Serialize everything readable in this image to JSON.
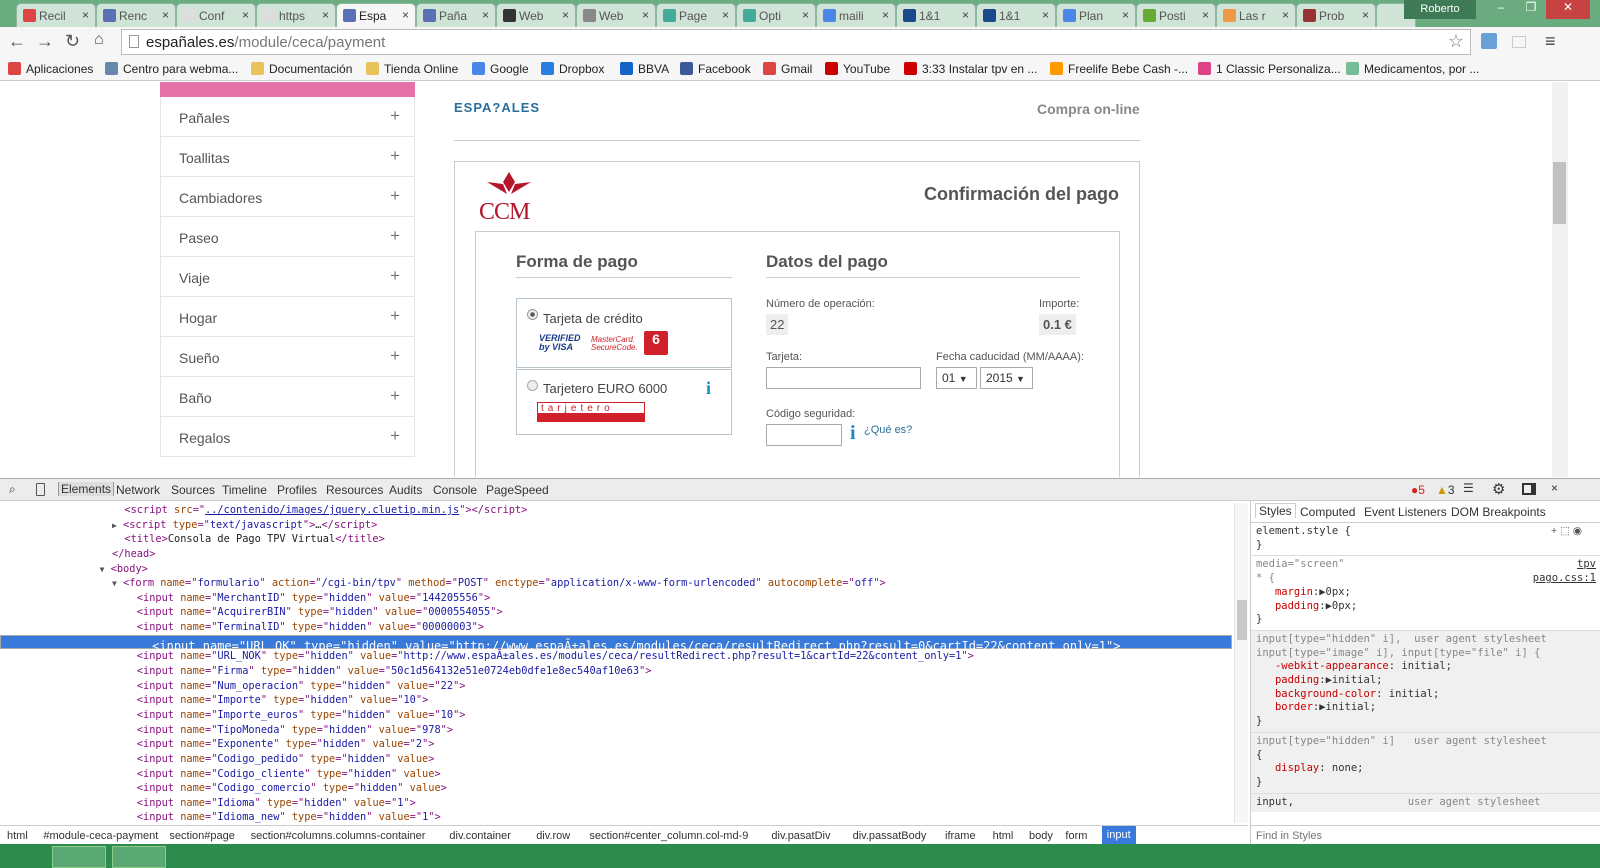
{
  "browser": {
    "tabs": [
      {
        "label": "Recil",
        "color": "#d44"
      },
      {
        "label": "Renc",
        "color": "#5b6fb5"
      },
      {
        "label": "Conf",
        "color": "#ddd"
      },
      {
        "label": "https",
        "color": "#ddd"
      },
      {
        "label": "Espa",
        "color": "#5b6fb5",
        "active": true
      },
      {
        "label": "Paña",
        "color": "#5b6fb5"
      },
      {
        "label": "Web",
        "color": "#333"
      },
      {
        "label": "Web",
        "color": "#888"
      },
      {
        "label": "Page",
        "color": "#4a9"
      },
      {
        "label": "Opti",
        "color": "#4a9"
      },
      {
        "label": "maili",
        "color": "#4a86e8"
      },
      {
        "label": "1&1",
        "color": "#1b4a8a"
      },
      {
        "label": "1&1",
        "color": "#1b4a8a"
      },
      {
        "label": "Plan",
        "color": "#4a86e8"
      },
      {
        "label": "Posti",
        "color": "#6a3"
      },
      {
        "label": "Las r",
        "color": "#e94"
      },
      {
        "label": "Prob",
        "color": "#933"
      }
    ],
    "profile": "Roberto",
    "url_host": "españales.es",
    "url_path": "/module/ceca/payment",
    "bookmarks": [
      {
        "label": "Aplicaciones",
        "color": "#d44"
      },
      {
        "label": "Centro para webma...",
        "color": "#68a"
      },
      {
        "label": "Documentación",
        "color": "#e8c35a"
      },
      {
        "label": "Tienda Online",
        "color": "#e8c35a"
      },
      {
        "label": "Google",
        "color": "#4a86e8"
      },
      {
        "label": "Dropbox",
        "color": "#2a7de1"
      },
      {
        "label": "BBVA",
        "color": "#1464c8"
      },
      {
        "label": "Facebook",
        "color": "#3b5998"
      },
      {
        "label": "Gmail",
        "color": "#d44"
      },
      {
        "label": "YouTube",
        "color": "#c00"
      },
      {
        "label": "3:33 Instalar tpv en ...",
        "color": "#c00"
      },
      {
        "label": "Freelife Bebe Cash -...",
        "color": "#f90"
      },
      {
        "label": "1 Classic Personaliza...",
        "color": "#d48"
      },
      {
        "label": "Medicamentos, por ...",
        "color": "#7b9"
      }
    ]
  },
  "sidebar": {
    "categories": [
      "Pañales",
      "Toallitas",
      "Cambiadores",
      "Paseo",
      "Viaje",
      "Hogar",
      "Sueño",
      "Baño",
      "Regalos"
    ],
    "plus": "+"
  },
  "payment": {
    "brand": "ESPA?ALES",
    "header_right": "Compra on-line",
    "logo_text": "CCM",
    "title": "Confirmación del pago",
    "forma_title": "Forma de pago",
    "option_credit": "Tarjeta de crédito",
    "verified": "VERIFIED by VISA",
    "mastercard": "MasterCard. SecureCode.",
    "option_euro": "Tarjetero EURO 6000",
    "tarjetero_logo": "tarjetero",
    "datos_title": "Datos del pago",
    "num_op_label": "Número de operación:",
    "num_op_value": "22",
    "importe_label": "Importe:",
    "importe_value": "0.1 €",
    "tarjeta_label": "Tarjeta:",
    "fecha_label": "Fecha caducidad (MM/AAAA):",
    "month": "01",
    "year": "2015",
    "codigo_label": "Código seguridad:",
    "que_es": "¿Qué es?"
  },
  "devtools": {
    "tabs": [
      "Elements",
      "Network",
      "Sources",
      "Timeline",
      "Profiles",
      "Resources",
      "Audits",
      "Console",
      "PageSpeed"
    ],
    "errors": "5",
    "warnings": "3",
    "code_lines": [
      {
        "indent": "          ",
        "text": "<script src=\"../contenido/images/jquery.cluetip.min.js\"></script>"
      },
      {
        "indent": "          ",
        "arrow": "▶",
        "text": "<script type=\"text/javascript\">…</script>"
      },
      {
        "indent": "          ",
        "text": "<title>Consola de Pago TPV Virtual</title>"
      },
      {
        "indent": "        ",
        "text": "</head>"
      },
      {
        "indent": "        ",
        "arrow": "▼",
        "text": "<body>"
      },
      {
        "indent": "          ",
        "arrow": "▼",
        "text": "<form name=\"formulario\" action=\"/cgi-bin/tpv\" method=\"POST\" enctype=\"application/x-www-form-urlencoded\" autocomplete=\"off\">"
      },
      {
        "indent": "            ",
        "text": "<input name=\"MerchantID\" type=\"hidden\" value=\"144205556\">"
      },
      {
        "indent": "            ",
        "text": "<input name=\"AcquirerBIN\" type=\"hidden\" value=\"0000554055\">"
      },
      {
        "indent": "            ",
        "text": "<input name=\"TerminalID\" type=\"hidden\" value=\"00000003\">"
      },
      {
        "indent": "            ",
        "selected": true,
        "text": "<input name=\"URL_OK\" type=\"hidden\" value=\"http://www.espaÃ±ales.es/modules/ceca/resultRedirect.php?result=0&cartId=22&content_only=1\">"
      },
      {
        "indent": "            ",
        "text": "<input name=\"URL_NOK\" type=\"hidden\" value=\"http://www.espaÃ±ales.es/modules/ceca/resultRedirect.php?result=1&cartId=22&content_only=1\">"
      },
      {
        "indent": "            ",
        "text": "<input name=\"Firma\" type=\"hidden\" value=\"50c1d564132e51e0724eb0dfe1e8ec540af10e63\">"
      },
      {
        "indent": "            ",
        "text": "<input name=\"Num_operacion\" type=\"hidden\" value=\"22\">"
      },
      {
        "indent": "            ",
        "text": "<input name=\"Importe\" type=\"hidden\" value=\"10\">"
      },
      {
        "indent": "            ",
        "text": "<input name=\"Importe_euros\" type=\"hidden\" value=\"10\">"
      },
      {
        "indent": "            ",
        "text": "<input name=\"TipoMoneda\" type=\"hidden\" value=\"978\">"
      },
      {
        "indent": "            ",
        "text": "<input name=\"Exponente\" type=\"hidden\" value=\"2\">"
      },
      {
        "indent": "            ",
        "text": "<input name=\"Codigo_pedido\" type=\"hidden\" value>"
      },
      {
        "indent": "            ",
        "text": "<input name=\"Codigo_cliente\" type=\"hidden\" value>"
      },
      {
        "indent": "            ",
        "text": "<input name=\"Codigo_comercio\" type=\"hidden\" value>"
      },
      {
        "indent": "            ",
        "text": "<input name=\"Idioma\" type=\"hidden\" value=\"1\">"
      },
      {
        "indent": "            ",
        "text": "<input name=\"Idioma_new\" type=\"hidden\" value=\"1\">"
      }
    ],
    "styles_tabs": [
      "Styles",
      "Computed",
      "Event Listeners",
      "DOM Breakpoints"
    ],
    "styles": {
      "element_style": "element.style {",
      "close": "}",
      "media": "media=\"screen\"",
      "src1": "tpv",
      "src2": "pago.css:1",
      "star": "* {",
      "margin": "margin",
      "margin_val": "▶0px;",
      "padding": "padding",
      "padding_val": "▶0px;",
      "ua_sel1": "input[type=\"hidden\" i],",
      "ua_sel1b": "input[type=\"image\" i], input[type=\"file\" i] {",
      "ua_label": "user agent stylesheet",
      "p1": "-webkit-appearance",
      "v1": "initial;",
      "p2": "padding",
      "v2": "▶initial;",
      "p3": "background-color",
      "v3": "initial;",
      "p4": "border",
      "v4": "▶initial;",
      "ua_sel2": "input[type=\"hidden\" i]",
      "open": "{",
      "p5": "display",
      "v5": "none;",
      "ua_sel3": "input,",
      "find_placeholder": "Find in Styles"
    },
    "breadcrumbs": [
      "html",
      "#module-ceca-payment",
      "section#page",
      "section#columns.columns-container",
      "div.container",
      "div.row",
      "section#center_column.col-md-9",
      "div.pasatDiv",
      "div.passatBody",
      "iframe",
      "html",
      "body",
      "form",
      "input"
    ]
  }
}
